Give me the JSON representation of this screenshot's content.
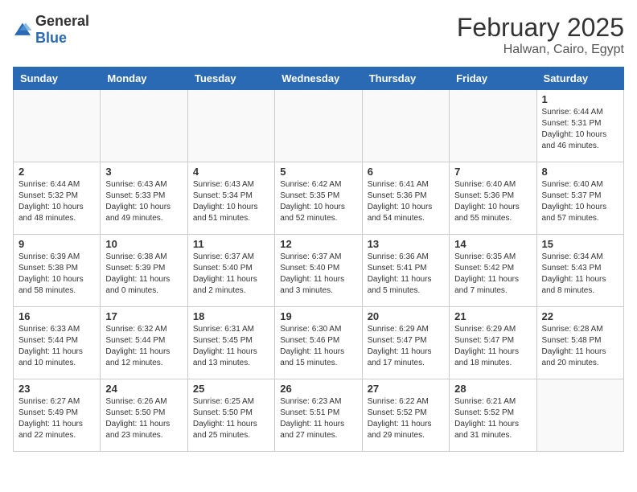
{
  "logo": {
    "general": "General",
    "blue": "Blue"
  },
  "title": "February 2025",
  "location": "Halwan, Cairo, Egypt",
  "weekdays": [
    "Sunday",
    "Monday",
    "Tuesday",
    "Wednesday",
    "Thursday",
    "Friday",
    "Saturday"
  ],
  "weeks": [
    [
      {
        "day": "",
        "info": ""
      },
      {
        "day": "",
        "info": ""
      },
      {
        "day": "",
        "info": ""
      },
      {
        "day": "",
        "info": ""
      },
      {
        "day": "",
        "info": ""
      },
      {
        "day": "",
        "info": ""
      },
      {
        "day": "1",
        "info": "Sunrise: 6:44 AM\nSunset: 5:31 PM\nDaylight: 10 hours\nand 46 minutes."
      }
    ],
    [
      {
        "day": "2",
        "info": "Sunrise: 6:44 AM\nSunset: 5:32 PM\nDaylight: 10 hours\nand 48 minutes."
      },
      {
        "day": "3",
        "info": "Sunrise: 6:43 AM\nSunset: 5:33 PM\nDaylight: 10 hours\nand 49 minutes."
      },
      {
        "day": "4",
        "info": "Sunrise: 6:43 AM\nSunset: 5:34 PM\nDaylight: 10 hours\nand 51 minutes."
      },
      {
        "day": "5",
        "info": "Sunrise: 6:42 AM\nSunset: 5:35 PM\nDaylight: 10 hours\nand 52 minutes."
      },
      {
        "day": "6",
        "info": "Sunrise: 6:41 AM\nSunset: 5:36 PM\nDaylight: 10 hours\nand 54 minutes."
      },
      {
        "day": "7",
        "info": "Sunrise: 6:40 AM\nSunset: 5:36 PM\nDaylight: 10 hours\nand 55 minutes."
      },
      {
        "day": "8",
        "info": "Sunrise: 6:40 AM\nSunset: 5:37 PM\nDaylight: 10 hours\nand 57 minutes."
      }
    ],
    [
      {
        "day": "9",
        "info": "Sunrise: 6:39 AM\nSunset: 5:38 PM\nDaylight: 10 hours\nand 58 minutes."
      },
      {
        "day": "10",
        "info": "Sunrise: 6:38 AM\nSunset: 5:39 PM\nDaylight: 11 hours\nand 0 minutes."
      },
      {
        "day": "11",
        "info": "Sunrise: 6:37 AM\nSunset: 5:40 PM\nDaylight: 11 hours\nand 2 minutes."
      },
      {
        "day": "12",
        "info": "Sunrise: 6:37 AM\nSunset: 5:40 PM\nDaylight: 11 hours\nand 3 minutes."
      },
      {
        "day": "13",
        "info": "Sunrise: 6:36 AM\nSunset: 5:41 PM\nDaylight: 11 hours\nand 5 minutes."
      },
      {
        "day": "14",
        "info": "Sunrise: 6:35 AM\nSunset: 5:42 PM\nDaylight: 11 hours\nand 7 minutes."
      },
      {
        "day": "15",
        "info": "Sunrise: 6:34 AM\nSunset: 5:43 PM\nDaylight: 11 hours\nand 8 minutes."
      }
    ],
    [
      {
        "day": "16",
        "info": "Sunrise: 6:33 AM\nSunset: 5:44 PM\nDaylight: 11 hours\nand 10 minutes."
      },
      {
        "day": "17",
        "info": "Sunrise: 6:32 AM\nSunset: 5:44 PM\nDaylight: 11 hours\nand 12 minutes."
      },
      {
        "day": "18",
        "info": "Sunrise: 6:31 AM\nSunset: 5:45 PM\nDaylight: 11 hours\nand 13 minutes."
      },
      {
        "day": "19",
        "info": "Sunrise: 6:30 AM\nSunset: 5:46 PM\nDaylight: 11 hours\nand 15 minutes."
      },
      {
        "day": "20",
        "info": "Sunrise: 6:29 AM\nSunset: 5:47 PM\nDaylight: 11 hours\nand 17 minutes."
      },
      {
        "day": "21",
        "info": "Sunrise: 6:29 AM\nSunset: 5:47 PM\nDaylight: 11 hours\nand 18 minutes."
      },
      {
        "day": "22",
        "info": "Sunrise: 6:28 AM\nSunset: 5:48 PM\nDaylight: 11 hours\nand 20 minutes."
      }
    ],
    [
      {
        "day": "23",
        "info": "Sunrise: 6:27 AM\nSunset: 5:49 PM\nDaylight: 11 hours\nand 22 minutes."
      },
      {
        "day": "24",
        "info": "Sunrise: 6:26 AM\nSunset: 5:50 PM\nDaylight: 11 hours\nand 23 minutes."
      },
      {
        "day": "25",
        "info": "Sunrise: 6:25 AM\nSunset: 5:50 PM\nDaylight: 11 hours\nand 25 minutes."
      },
      {
        "day": "26",
        "info": "Sunrise: 6:23 AM\nSunset: 5:51 PM\nDaylight: 11 hours\nand 27 minutes."
      },
      {
        "day": "27",
        "info": "Sunrise: 6:22 AM\nSunset: 5:52 PM\nDaylight: 11 hours\nand 29 minutes."
      },
      {
        "day": "28",
        "info": "Sunrise: 6:21 AM\nSunset: 5:52 PM\nDaylight: 11 hours\nand 31 minutes."
      },
      {
        "day": "",
        "info": ""
      }
    ]
  ]
}
